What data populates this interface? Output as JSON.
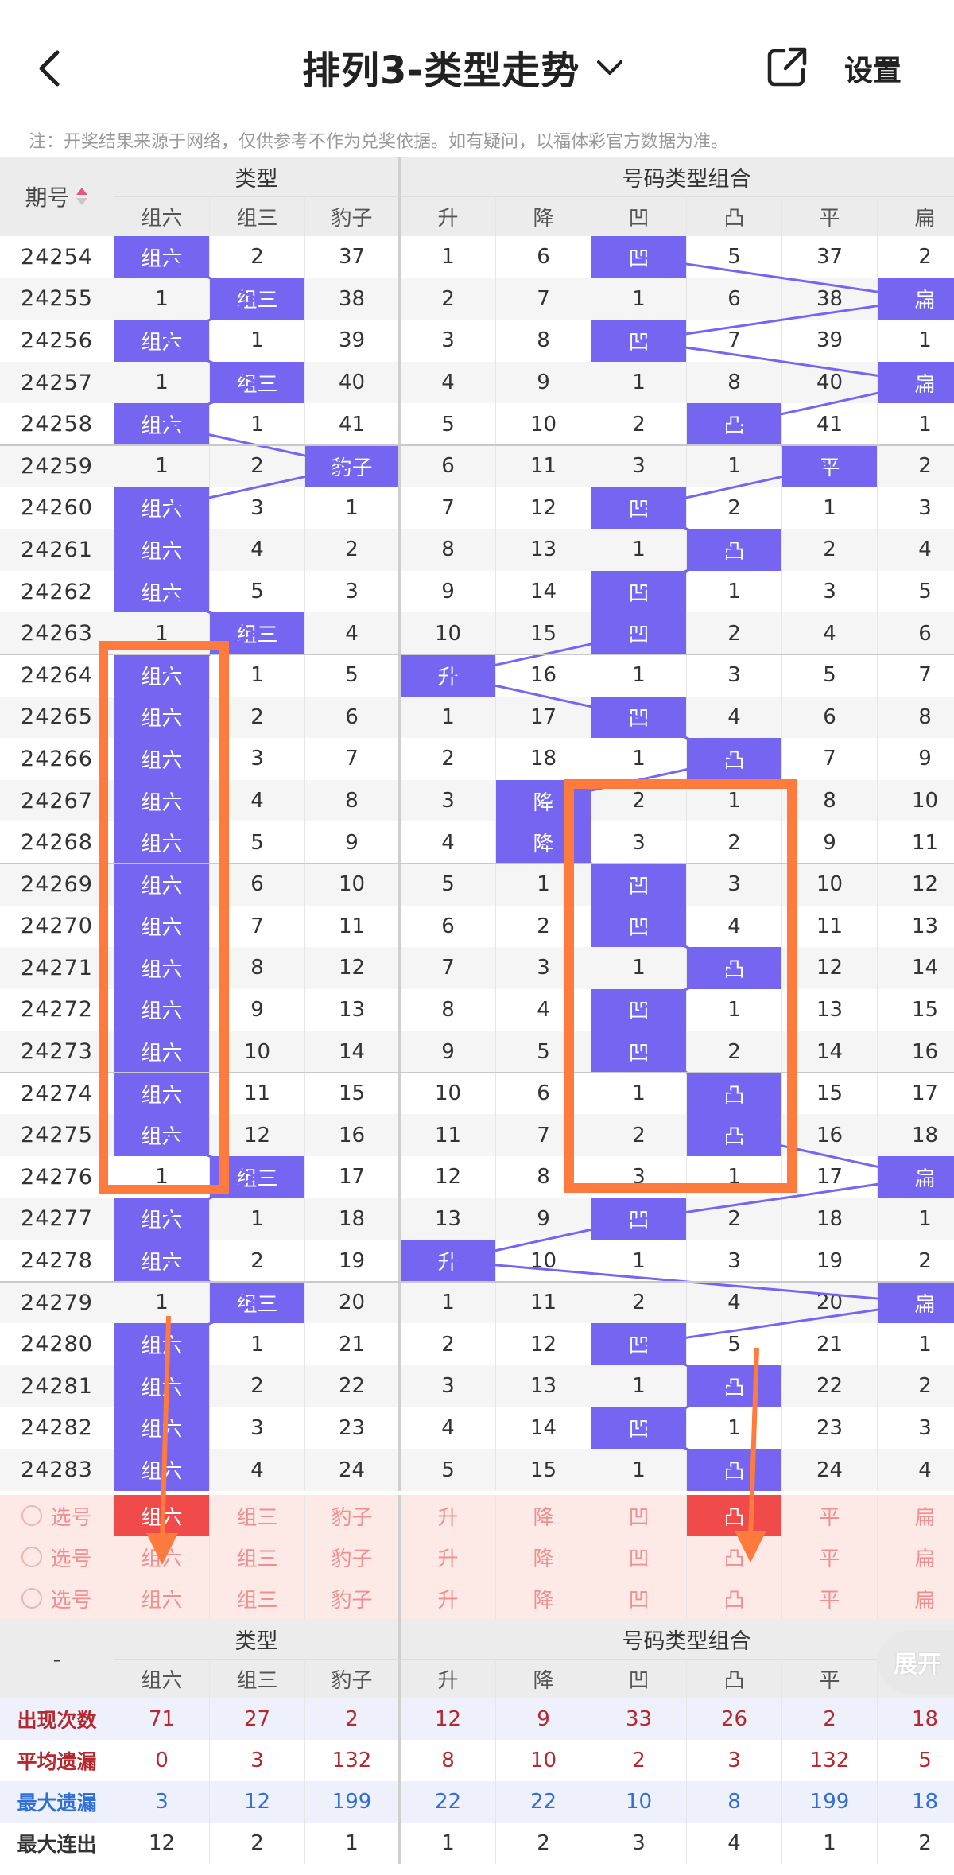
{
  "header": {
    "title": "排列3-类型走势",
    "settings_label": "设置",
    "back_icon": "chevron-left-icon",
    "dropdown_icon": "chevron-down-icon",
    "share_icon": "share-icon"
  },
  "notice": "注：开奖结果来源于网络，仅供参考不作为兑奖依据。如有疑问，以福体彩官方数据为准。",
  "table": {
    "period_header": "期号",
    "group_type": "类型",
    "group_combo": "号码类型组合",
    "columns": [
      "组六",
      "组三",
      "豹子",
      "升",
      "降",
      "凹",
      "凸",
      "平",
      "扁"
    ],
    "rows": [
      {
        "p": "24254",
        "v": [
          "组六",
          "2",
          "37",
          "1",
          "6",
          "凹",
          "5",
          "37",
          "2"
        ]
      },
      {
        "p": "24255",
        "v": [
          "1",
          "组三",
          "38",
          "2",
          "7",
          "1",
          "6",
          "38",
          "扁"
        ]
      },
      {
        "p": "24256",
        "v": [
          "组六",
          "1",
          "39",
          "3",
          "8",
          "凹",
          "7",
          "39",
          "1"
        ]
      },
      {
        "p": "24257",
        "v": [
          "1",
          "组三",
          "40",
          "4",
          "9",
          "1",
          "8",
          "40",
          "扁"
        ]
      },
      {
        "p": "24258",
        "v": [
          "组六",
          "1",
          "41",
          "5",
          "10",
          "2",
          "凸",
          "41",
          "1"
        ]
      },
      {
        "p": "24259",
        "v": [
          "1",
          "2",
          "豹子",
          "6",
          "11",
          "3",
          "1",
          "平",
          "2"
        ]
      },
      {
        "p": "24260",
        "v": [
          "组六",
          "3",
          "1",
          "7",
          "12",
          "凹",
          "2",
          "1",
          "3"
        ]
      },
      {
        "p": "24261",
        "v": [
          "组六",
          "4",
          "2",
          "8",
          "13",
          "1",
          "凸",
          "2",
          "4"
        ]
      },
      {
        "p": "24262",
        "v": [
          "组六",
          "5",
          "3",
          "9",
          "14",
          "凹",
          "1",
          "3",
          "5"
        ]
      },
      {
        "p": "24263",
        "v": [
          "1",
          "组三",
          "4",
          "10",
          "15",
          "凹",
          "2",
          "4",
          "6"
        ]
      },
      {
        "p": "24264",
        "v": [
          "组六",
          "1",
          "5",
          "升",
          "16",
          "1",
          "3",
          "5",
          "7"
        ]
      },
      {
        "p": "24265",
        "v": [
          "组六",
          "2",
          "6",
          "1",
          "17",
          "凹",
          "4",
          "6",
          "8"
        ]
      },
      {
        "p": "24266",
        "v": [
          "组六",
          "3",
          "7",
          "2",
          "18",
          "1",
          "凸",
          "7",
          "9"
        ]
      },
      {
        "p": "24267",
        "v": [
          "组六",
          "4",
          "8",
          "3",
          "降",
          "2",
          "1",
          "8",
          "10"
        ]
      },
      {
        "p": "24268",
        "v": [
          "组六",
          "5",
          "9",
          "4",
          "降",
          "3",
          "2",
          "9",
          "11"
        ]
      },
      {
        "p": "24269",
        "v": [
          "组六",
          "6",
          "10",
          "5",
          "1",
          "凹",
          "3",
          "10",
          "12"
        ]
      },
      {
        "p": "24270",
        "v": [
          "组六",
          "7",
          "11",
          "6",
          "2",
          "凹",
          "4",
          "11",
          "13"
        ]
      },
      {
        "p": "24271",
        "v": [
          "组六",
          "8",
          "12",
          "7",
          "3",
          "1",
          "凸",
          "12",
          "14"
        ]
      },
      {
        "p": "24272",
        "v": [
          "组六",
          "9",
          "13",
          "8",
          "4",
          "凹",
          "1",
          "13",
          "15"
        ]
      },
      {
        "p": "24273",
        "v": [
          "组六",
          "10",
          "14",
          "9",
          "5",
          "凹",
          "2",
          "14",
          "16"
        ]
      },
      {
        "p": "24274",
        "v": [
          "组六",
          "11",
          "15",
          "10",
          "6",
          "1",
          "凸",
          "15",
          "17"
        ]
      },
      {
        "p": "24275",
        "v": [
          "组六",
          "12",
          "16",
          "11",
          "7",
          "2",
          "凸",
          "16",
          "18"
        ]
      },
      {
        "p": "24276",
        "v": [
          "1",
          "组三",
          "17",
          "12",
          "8",
          "3",
          "1",
          "17",
          "扁"
        ]
      },
      {
        "p": "24277",
        "v": [
          "组六",
          "1",
          "18",
          "13",
          "9",
          "凹",
          "2",
          "18",
          "1"
        ]
      },
      {
        "p": "24278",
        "v": [
          "组六",
          "2",
          "19",
          "升",
          "10",
          "1",
          "3",
          "19",
          "2"
        ]
      },
      {
        "p": "24279",
        "v": [
          "1",
          "组三",
          "20",
          "1",
          "11",
          "2",
          "4",
          "20",
          "扁"
        ]
      },
      {
        "p": "24280",
        "v": [
          "组六",
          "1",
          "21",
          "2",
          "12",
          "凹",
          "5",
          "21",
          "1"
        ]
      },
      {
        "p": "24281",
        "v": [
          "组六",
          "2",
          "22",
          "3",
          "13",
          "1",
          "凸",
          "22",
          "2"
        ]
      },
      {
        "p": "24282",
        "v": [
          "组六",
          "3",
          "23",
          "4",
          "14",
          "凹",
          "1",
          "23",
          "3"
        ]
      },
      {
        "p": "24283",
        "v": [
          "组六",
          "4",
          "24",
          "5",
          "15",
          "1",
          "凸",
          "24",
          "4"
        ]
      }
    ],
    "pick_label": "选号",
    "pick_rows": 3,
    "pick_selected_first_row": [
      "组六",
      "凸"
    ]
  },
  "summary": {
    "dash": "-",
    "expand_label": "展开",
    "stats": [
      {
        "label": "出现次数",
        "values": [
          "71",
          "27",
          "2",
          "12",
          "9",
          "33",
          "26",
          "2",
          "18"
        ],
        "color": "red"
      },
      {
        "label": "平均遗漏",
        "values": [
          "0",
          "3",
          "132",
          "8",
          "10",
          "2",
          "3",
          "132",
          "5"
        ],
        "color": "red"
      },
      {
        "label": "最大遗漏",
        "values": [
          "3",
          "12",
          "199",
          "22",
          "22",
          "10",
          "8",
          "199",
          "18"
        ],
        "color": "blue"
      },
      {
        "label": "最大连出",
        "values": [
          "12",
          "2",
          "1",
          "1",
          "2",
          "3",
          "4",
          "1",
          "2"
        ],
        "color": "dark"
      }
    ]
  },
  "colors": {
    "hit": "#7665f1",
    "hit_selected": "#f04a4a",
    "annotation": "#ff7a3d",
    "stat_red": "#b5282e",
    "stat_blue": "#2f6fd6"
  }
}
